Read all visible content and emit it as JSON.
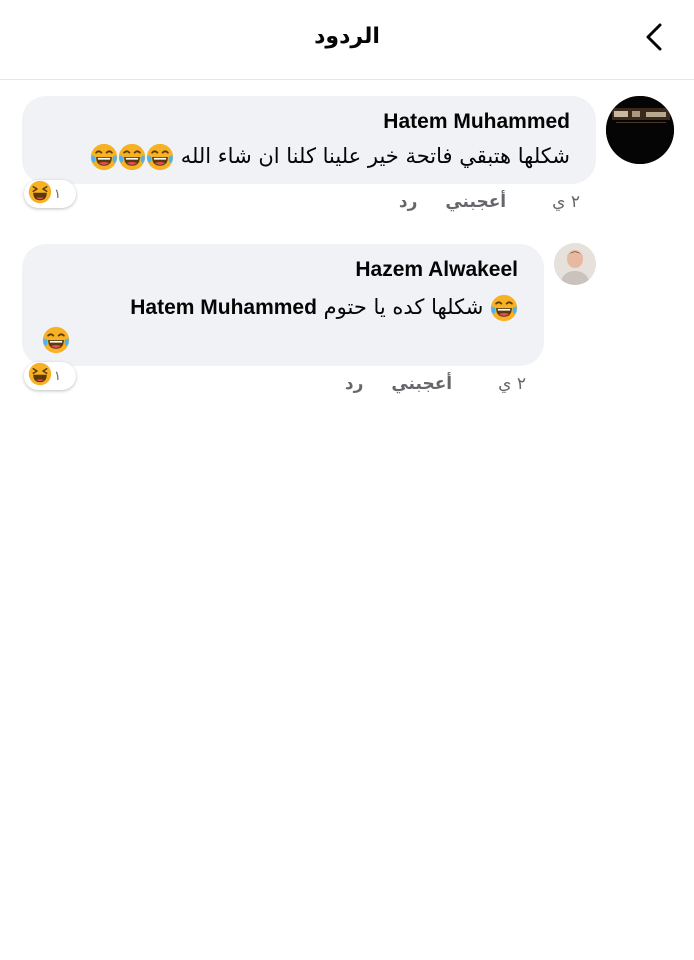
{
  "header": {
    "title": "الردود"
  },
  "icons": {
    "back": "chevron-left-icon",
    "laugh": "laughing-tears-emoji",
    "haha_reaction": "haha-reaction-icon"
  },
  "colors": {
    "bubble": "#f0f2f5",
    "text": "#050505",
    "meta": "#65676b",
    "divider": "#e4e6eb"
  },
  "comments": [
    {
      "author": "Hatem Muhammed",
      "text": "شكلها هتبقي فاتحة خير علينا كلنا ان شاء الله",
      "emoji_count": 3,
      "reaction_count": "١",
      "time": "٢ ي",
      "like_label": "أعجبني",
      "reply_label": "رد"
    },
    {
      "author": "Hazem Alwakeel",
      "mention": "Hatem Muhammed",
      "text": "شكلها كده يا حتوم",
      "reaction_count": "١",
      "time": "٢ ي",
      "like_label": "أعجبني",
      "reply_label": "رد"
    }
  ]
}
